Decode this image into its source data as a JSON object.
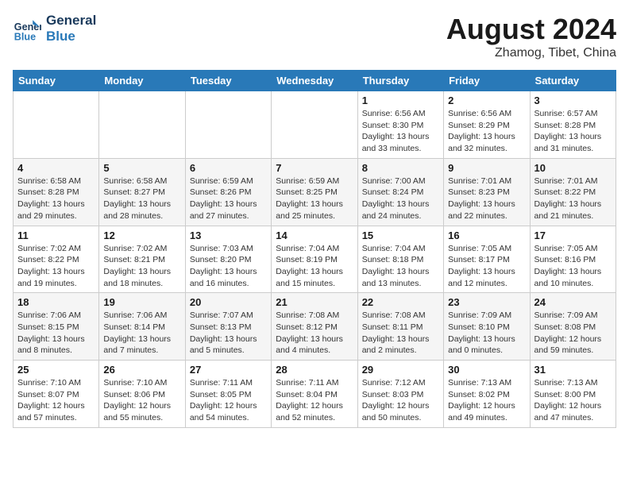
{
  "logo": {
    "line1": "General",
    "line2": "Blue"
  },
  "title": {
    "month_year": "August 2024",
    "location": "Zhamog, Tibet, China"
  },
  "days_of_week": [
    "Sunday",
    "Monday",
    "Tuesday",
    "Wednesday",
    "Thursday",
    "Friday",
    "Saturday"
  ],
  "weeks": [
    [
      {
        "day": "",
        "detail": ""
      },
      {
        "day": "",
        "detail": ""
      },
      {
        "day": "",
        "detail": ""
      },
      {
        "day": "",
        "detail": ""
      },
      {
        "day": "1",
        "detail": "Sunrise: 6:56 AM\nSunset: 8:30 PM\nDaylight: 13 hours\nand 33 minutes."
      },
      {
        "day": "2",
        "detail": "Sunrise: 6:56 AM\nSunset: 8:29 PM\nDaylight: 13 hours\nand 32 minutes."
      },
      {
        "day": "3",
        "detail": "Sunrise: 6:57 AM\nSunset: 8:28 PM\nDaylight: 13 hours\nand 31 minutes."
      }
    ],
    [
      {
        "day": "4",
        "detail": "Sunrise: 6:58 AM\nSunset: 8:28 PM\nDaylight: 13 hours\nand 29 minutes."
      },
      {
        "day": "5",
        "detail": "Sunrise: 6:58 AM\nSunset: 8:27 PM\nDaylight: 13 hours\nand 28 minutes."
      },
      {
        "day": "6",
        "detail": "Sunrise: 6:59 AM\nSunset: 8:26 PM\nDaylight: 13 hours\nand 27 minutes."
      },
      {
        "day": "7",
        "detail": "Sunrise: 6:59 AM\nSunset: 8:25 PM\nDaylight: 13 hours\nand 25 minutes."
      },
      {
        "day": "8",
        "detail": "Sunrise: 7:00 AM\nSunset: 8:24 PM\nDaylight: 13 hours\nand 24 minutes."
      },
      {
        "day": "9",
        "detail": "Sunrise: 7:01 AM\nSunset: 8:23 PM\nDaylight: 13 hours\nand 22 minutes."
      },
      {
        "day": "10",
        "detail": "Sunrise: 7:01 AM\nSunset: 8:22 PM\nDaylight: 13 hours\nand 21 minutes."
      }
    ],
    [
      {
        "day": "11",
        "detail": "Sunrise: 7:02 AM\nSunset: 8:22 PM\nDaylight: 13 hours\nand 19 minutes."
      },
      {
        "day": "12",
        "detail": "Sunrise: 7:02 AM\nSunset: 8:21 PM\nDaylight: 13 hours\nand 18 minutes."
      },
      {
        "day": "13",
        "detail": "Sunrise: 7:03 AM\nSunset: 8:20 PM\nDaylight: 13 hours\nand 16 minutes."
      },
      {
        "day": "14",
        "detail": "Sunrise: 7:04 AM\nSunset: 8:19 PM\nDaylight: 13 hours\nand 15 minutes."
      },
      {
        "day": "15",
        "detail": "Sunrise: 7:04 AM\nSunset: 8:18 PM\nDaylight: 13 hours\nand 13 minutes."
      },
      {
        "day": "16",
        "detail": "Sunrise: 7:05 AM\nSunset: 8:17 PM\nDaylight: 13 hours\nand 12 minutes."
      },
      {
        "day": "17",
        "detail": "Sunrise: 7:05 AM\nSunset: 8:16 PM\nDaylight: 13 hours\nand 10 minutes."
      }
    ],
    [
      {
        "day": "18",
        "detail": "Sunrise: 7:06 AM\nSunset: 8:15 PM\nDaylight: 13 hours\nand 8 minutes."
      },
      {
        "day": "19",
        "detail": "Sunrise: 7:06 AM\nSunset: 8:14 PM\nDaylight: 13 hours\nand 7 minutes."
      },
      {
        "day": "20",
        "detail": "Sunrise: 7:07 AM\nSunset: 8:13 PM\nDaylight: 13 hours\nand 5 minutes."
      },
      {
        "day": "21",
        "detail": "Sunrise: 7:08 AM\nSunset: 8:12 PM\nDaylight: 13 hours\nand 4 minutes."
      },
      {
        "day": "22",
        "detail": "Sunrise: 7:08 AM\nSunset: 8:11 PM\nDaylight: 13 hours\nand 2 minutes."
      },
      {
        "day": "23",
        "detail": "Sunrise: 7:09 AM\nSunset: 8:10 PM\nDaylight: 13 hours\nand 0 minutes."
      },
      {
        "day": "24",
        "detail": "Sunrise: 7:09 AM\nSunset: 8:08 PM\nDaylight: 12 hours\nand 59 minutes."
      }
    ],
    [
      {
        "day": "25",
        "detail": "Sunrise: 7:10 AM\nSunset: 8:07 PM\nDaylight: 12 hours\nand 57 minutes."
      },
      {
        "day": "26",
        "detail": "Sunrise: 7:10 AM\nSunset: 8:06 PM\nDaylight: 12 hours\nand 55 minutes."
      },
      {
        "day": "27",
        "detail": "Sunrise: 7:11 AM\nSunset: 8:05 PM\nDaylight: 12 hours\nand 54 minutes."
      },
      {
        "day": "28",
        "detail": "Sunrise: 7:11 AM\nSunset: 8:04 PM\nDaylight: 12 hours\nand 52 minutes."
      },
      {
        "day": "29",
        "detail": "Sunrise: 7:12 AM\nSunset: 8:03 PM\nDaylight: 12 hours\nand 50 minutes."
      },
      {
        "day": "30",
        "detail": "Sunrise: 7:13 AM\nSunset: 8:02 PM\nDaylight: 12 hours\nand 49 minutes."
      },
      {
        "day": "31",
        "detail": "Sunrise: 7:13 AM\nSunset: 8:00 PM\nDaylight: 12 hours\nand 47 minutes."
      }
    ]
  ]
}
